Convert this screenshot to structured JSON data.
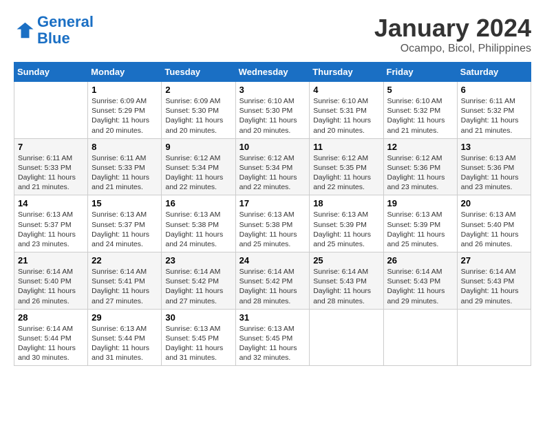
{
  "logo": {
    "line1": "General",
    "line2": "Blue"
  },
  "title": "January 2024",
  "location": "Ocampo, Bicol, Philippines",
  "headers": [
    "Sunday",
    "Monday",
    "Tuesday",
    "Wednesday",
    "Thursday",
    "Friday",
    "Saturday"
  ],
  "weeks": [
    [
      {
        "day": "",
        "sunrise": "",
        "sunset": "",
        "daylight": ""
      },
      {
        "day": "1",
        "sunrise": "6:09 AM",
        "sunset": "5:29 PM",
        "daylight": "11 hours and 20 minutes."
      },
      {
        "day": "2",
        "sunrise": "6:09 AM",
        "sunset": "5:30 PM",
        "daylight": "11 hours and 20 minutes."
      },
      {
        "day": "3",
        "sunrise": "6:10 AM",
        "sunset": "5:30 PM",
        "daylight": "11 hours and 20 minutes."
      },
      {
        "day": "4",
        "sunrise": "6:10 AM",
        "sunset": "5:31 PM",
        "daylight": "11 hours and 20 minutes."
      },
      {
        "day": "5",
        "sunrise": "6:10 AM",
        "sunset": "5:32 PM",
        "daylight": "11 hours and 21 minutes."
      },
      {
        "day": "6",
        "sunrise": "6:11 AM",
        "sunset": "5:32 PM",
        "daylight": "11 hours and 21 minutes."
      }
    ],
    [
      {
        "day": "7",
        "sunrise": "6:11 AM",
        "sunset": "5:33 PM",
        "daylight": "11 hours and 21 minutes."
      },
      {
        "day": "8",
        "sunrise": "6:11 AM",
        "sunset": "5:33 PM",
        "daylight": "11 hours and 21 minutes."
      },
      {
        "day": "9",
        "sunrise": "6:12 AM",
        "sunset": "5:34 PM",
        "daylight": "11 hours and 22 minutes."
      },
      {
        "day": "10",
        "sunrise": "6:12 AM",
        "sunset": "5:34 PM",
        "daylight": "11 hours and 22 minutes."
      },
      {
        "day": "11",
        "sunrise": "6:12 AM",
        "sunset": "5:35 PM",
        "daylight": "11 hours and 22 minutes."
      },
      {
        "day": "12",
        "sunrise": "6:12 AM",
        "sunset": "5:36 PM",
        "daylight": "11 hours and 23 minutes."
      },
      {
        "day": "13",
        "sunrise": "6:13 AM",
        "sunset": "5:36 PM",
        "daylight": "11 hours and 23 minutes."
      }
    ],
    [
      {
        "day": "14",
        "sunrise": "6:13 AM",
        "sunset": "5:37 PM",
        "daylight": "11 hours and 23 minutes."
      },
      {
        "day": "15",
        "sunrise": "6:13 AM",
        "sunset": "5:37 PM",
        "daylight": "11 hours and 24 minutes."
      },
      {
        "day": "16",
        "sunrise": "6:13 AM",
        "sunset": "5:38 PM",
        "daylight": "11 hours and 24 minutes."
      },
      {
        "day": "17",
        "sunrise": "6:13 AM",
        "sunset": "5:38 PM",
        "daylight": "11 hours and 25 minutes."
      },
      {
        "day": "18",
        "sunrise": "6:13 AM",
        "sunset": "5:39 PM",
        "daylight": "11 hours and 25 minutes."
      },
      {
        "day": "19",
        "sunrise": "6:13 AM",
        "sunset": "5:39 PM",
        "daylight": "11 hours and 25 minutes."
      },
      {
        "day": "20",
        "sunrise": "6:13 AM",
        "sunset": "5:40 PM",
        "daylight": "11 hours and 26 minutes."
      }
    ],
    [
      {
        "day": "21",
        "sunrise": "6:14 AM",
        "sunset": "5:40 PM",
        "daylight": "11 hours and 26 minutes."
      },
      {
        "day": "22",
        "sunrise": "6:14 AM",
        "sunset": "5:41 PM",
        "daylight": "11 hours and 27 minutes."
      },
      {
        "day": "23",
        "sunrise": "6:14 AM",
        "sunset": "5:42 PM",
        "daylight": "11 hours and 27 minutes."
      },
      {
        "day": "24",
        "sunrise": "6:14 AM",
        "sunset": "5:42 PM",
        "daylight": "11 hours and 28 minutes."
      },
      {
        "day": "25",
        "sunrise": "6:14 AM",
        "sunset": "5:43 PM",
        "daylight": "11 hours and 28 minutes."
      },
      {
        "day": "26",
        "sunrise": "6:14 AM",
        "sunset": "5:43 PM",
        "daylight": "11 hours and 29 minutes."
      },
      {
        "day": "27",
        "sunrise": "6:14 AM",
        "sunset": "5:43 PM",
        "daylight": "11 hours and 29 minutes."
      }
    ],
    [
      {
        "day": "28",
        "sunrise": "6:14 AM",
        "sunset": "5:44 PM",
        "daylight": "11 hours and 30 minutes."
      },
      {
        "day": "29",
        "sunrise": "6:13 AM",
        "sunset": "5:44 PM",
        "daylight": "11 hours and 31 minutes."
      },
      {
        "day": "30",
        "sunrise": "6:13 AM",
        "sunset": "5:45 PM",
        "daylight": "11 hours and 31 minutes."
      },
      {
        "day": "31",
        "sunrise": "6:13 AM",
        "sunset": "5:45 PM",
        "daylight": "11 hours and 32 minutes."
      },
      {
        "day": "",
        "sunrise": "",
        "sunset": "",
        "daylight": ""
      },
      {
        "day": "",
        "sunrise": "",
        "sunset": "",
        "daylight": ""
      },
      {
        "day": "",
        "sunrise": "",
        "sunset": "",
        "daylight": ""
      }
    ]
  ]
}
